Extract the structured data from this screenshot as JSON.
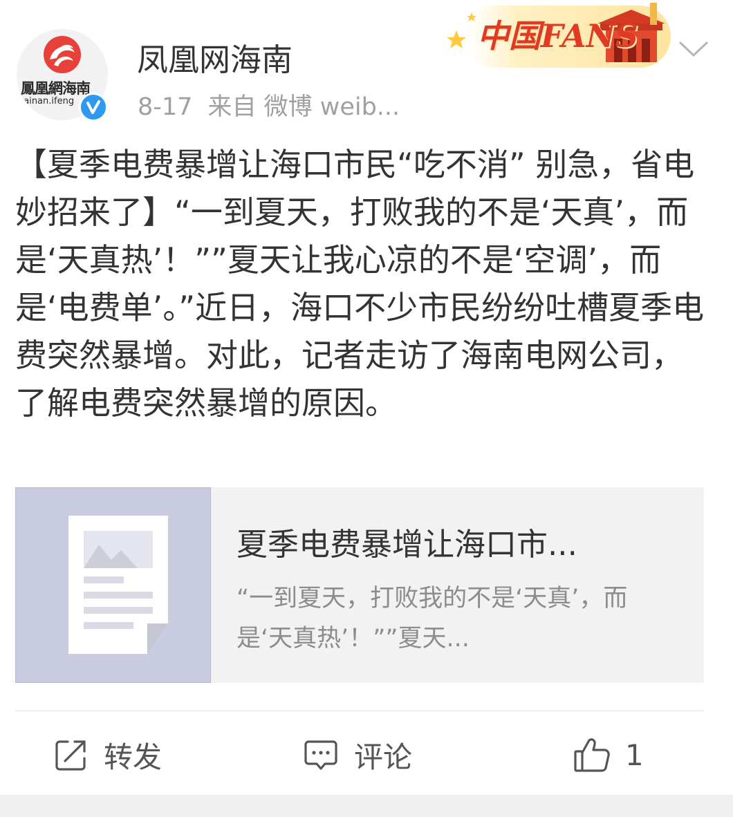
{
  "header": {
    "account_name": "凤凰网海南",
    "date": "8-17",
    "source": "来自 微博 weib...",
    "avatar_brand": "鳳凰網海南",
    "avatar_domain": "hainan.ifeng",
    "fans_badge": "中国FANS"
  },
  "post": {
    "text": "【夏季电费暴增让海口市民“吃不消” 别急，省电妙招来了】“一到夏天，打败我的不是‘天真’，而是‘天真热’！””夏天让我心凉的不是‘空调’，而是‘电费单’。”近日，海口不少市民纷纷吐槽夏季电费突然暴增。对此，记者走访了海南电网公司，了解电费突然暴增的原因。"
  },
  "link_card": {
    "title": "夏季电费暴增让海口市...",
    "description": "“一到夏天，打败我的不是‘天真’，而是‘天真热’！””夏天..."
  },
  "actions": {
    "repost": "转发",
    "comment": "评论",
    "like_count": "1"
  },
  "colors": {
    "accent_blue": "#2f98ef",
    "logo_red": "#e8403a",
    "meta_gray": "#a0a0a0"
  },
  "icons": [
    "ifeng-logo-icon",
    "verified-icon",
    "chevron-down-icon",
    "image-placeholder-icon",
    "repost-icon",
    "comment-icon",
    "like-icon"
  ]
}
